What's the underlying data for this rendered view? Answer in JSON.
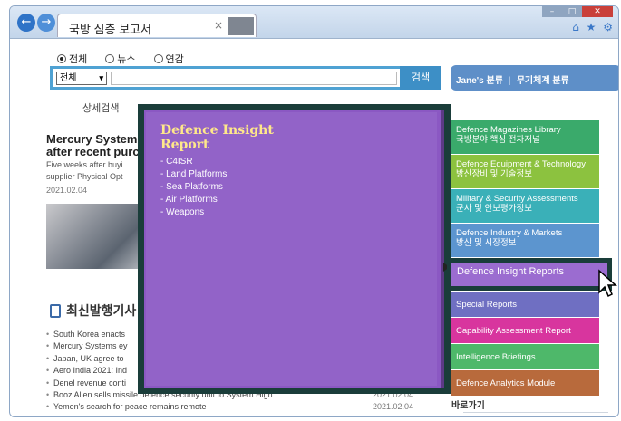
{
  "browser": {
    "tab_title": "국방 심층 보고서",
    "tab_close": "×",
    "back": "←",
    "forward": "→",
    "toolbar_icons": "⌂ ★ ⚙",
    "win_min": "–",
    "win_max": "□",
    "win_close": "✕"
  },
  "search": {
    "radios": [
      {
        "label": "전체",
        "selected": true
      },
      {
        "label": "뉴스",
        "selected": false
      },
      {
        "label": "연감",
        "selected": false
      }
    ],
    "select_value": "전체",
    "select_arrow": "▾",
    "input_value": "",
    "button_label": "검색"
  },
  "janes_bar": {
    "item1": "Jane's 분류",
    "separator": "|",
    "item2": "무기체계 분류"
  },
  "subnav": {
    "text": "상세검색"
  },
  "news": {
    "headline": "Mercury Systems after recent purc",
    "snippet_line1": "Five weeks after buyi",
    "snippet_line2": "supplier Physical Opt",
    "date": "2021.02.04"
  },
  "latest": {
    "heading": "최신발행기사",
    "items": [
      {
        "text": "South Korea enacts",
        "date": ""
      },
      {
        "text": "Mercury Systems ey",
        "date": ""
      },
      {
        "text": "Japan, UK agree to",
        "date": ""
      },
      {
        "text": "Aero India 2021: Ind",
        "date": ""
      },
      {
        "text": "Denel revenue conti",
        "date": ""
      },
      {
        "text": "Booz Allen sells missile defence security unit to System High",
        "date": "2021.02.04"
      },
      {
        "text": "Yemen's search for peace remains remote",
        "date": "2021.02.04"
      }
    ]
  },
  "overlay": {
    "title": "Defence Insight Report",
    "items": [
      "- C4ISR",
      "- Land Platforms",
      "- Sea Platforms",
      "- Air Platforms",
      "- Weapons"
    ]
  },
  "right_menu": {
    "items": [
      {
        "line1": "Defence Magazines Library",
        "line2": "국방분야 핵심 전자저널",
        "color": "#3aaa6b"
      },
      {
        "line1": "Defence Equipment & Technology",
        "line2": "방산장비 및 기술정보",
        "color": "#8cc23f"
      },
      {
        "line1": "Military & Security Assessments",
        "line2": "군사 및 안보평가정보",
        "color": "#3ab0b8"
      },
      {
        "line1": "Defence Industry & Markets",
        "line2": "방산 및 시장정보",
        "color": "#5c95cf"
      },
      {
        "line1": "Defence Insight Reports",
        "line2": "",
        "color": "#9b6cd0"
      },
      {
        "line1": "Special Reports",
        "line2": "",
        "color": "#6f6fc2"
      },
      {
        "line1": "Capability Assessment Report",
        "line2": "",
        "color": "#d8359e"
      },
      {
        "line1": "Intelligence Briefings",
        "line2": "",
        "color": "#4eb86a"
      },
      {
        "line1": "Defence Analytics Module",
        "line2": "",
        "color": "#b86a3c"
      }
    ],
    "active_index": 4
  },
  "shortcut": {
    "label": "바로가기"
  }
}
